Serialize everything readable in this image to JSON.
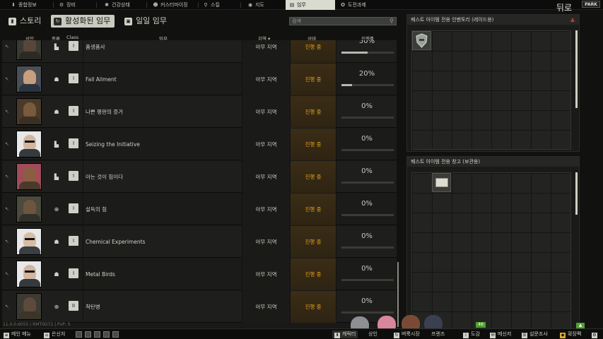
{
  "nav": {
    "tabs": [
      {
        "label": "종합정보",
        "icon": "download-icon"
      },
      {
        "label": "장비",
        "icon": "gear-icon"
      },
      {
        "label": "건강상태",
        "icon": "asterisk-icon"
      },
      {
        "label": "커스터마이징",
        "icon": "face-icon"
      },
      {
        "label": "스킬",
        "icon": "pin-icon"
      },
      {
        "label": "지도",
        "icon": "map-pin-icon"
      },
      {
        "label": "임무",
        "icon": "quest-icon",
        "active": true
      },
      {
        "label": "도전과제",
        "icon": "achievement-icon"
      }
    ],
    "back_label": "뒤로",
    "logo_text": "PARK"
  },
  "subtabs": {
    "story": "스토리",
    "active": "활성화된 임무",
    "daily": "일일 임무"
  },
  "search": {
    "placeholder": "검색"
  },
  "table": {
    "headers": {
      "trader": "상인",
      "type": "종류",
      "class": "Class",
      "quest": "임무",
      "location": "지역",
      "status": "상태",
      "progress": "진행률"
    },
    "rows": [
      {
        "name": "품생품사",
        "location": "아무 지역",
        "status": "진행 중",
        "progress_label": "50%",
        "progress": 0.5,
        "type": "book-icon",
        "class_icon": "I"
      },
      {
        "name": "Fall Ailment",
        "location": "아무 지역",
        "status": "진행 중",
        "progress_label": "20%",
        "progress": 0.2,
        "type": "hand-icon",
        "class_icon": "I"
      },
      {
        "name": "나쁜 평판의 증거",
        "location": "아무 지역",
        "status": "진행 중",
        "progress_label": "0%",
        "progress": 0,
        "type": "hand-icon",
        "class_icon": "I"
      },
      {
        "name": "Seizing the Initiative",
        "location": "아무 지역",
        "status": "진행 중",
        "progress_label": "0%",
        "progress": 0,
        "type": "book-icon",
        "class_icon": "I"
      },
      {
        "name": "아는 것이 힘이다",
        "location": "아무 지역",
        "status": "진행 중",
        "progress_label": "0%",
        "progress": 0,
        "type": "book-icon",
        "class_icon": "I"
      },
      {
        "name": "설득의 힘",
        "location": "아무 지역",
        "status": "진행 중",
        "progress_label": "0%",
        "progress": 0,
        "type": "crosshair-icon",
        "class_icon": "I"
      },
      {
        "name": "Chemical Experiments",
        "location": "아무 지역",
        "status": "진행 중",
        "progress_label": "0%",
        "progress": 0,
        "type": "hand-icon",
        "class_icon": "I"
      },
      {
        "name": "Metal Birds",
        "location": "아무 지역",
        "status": "진행 중",
        "progress_label": "0%",
        "progress": 0,
        "type": "hand-icon",
        "class_icon": "I"
      },
      {
        "name": "척탄병",
        "location": "아무 지역",
        "status": "진행 중",
        "progress_label": "0%",
        "progress": 0,
        "type": "crosshair-icon",
        "class_icon": "II"
      }
    ]
  },
  "panels": {
    "raid_inventory_title": "퀘스트 아이템 전용 인벤토리 (레이드용)",
    "stash_title": "퀘스트 아이템 전용 창고 (보관용)"
  },
  "version": "11.0.0.6055 | RMT0D72 | PvP: S",
  "bottom": {
    "main_menu": "메인 메뉴",
    "hideout": "은신처",
    "character": "캐릭터",
    "traders": "상인",
    "flea": "벼룩시장",
    "friends": "프렌즈",
    "handbook": "도감",
    "messenger": "메신저",
    "survey": "설문조사",
    "expand": "확장팩",
    "notification_count": "46"
  }
}
